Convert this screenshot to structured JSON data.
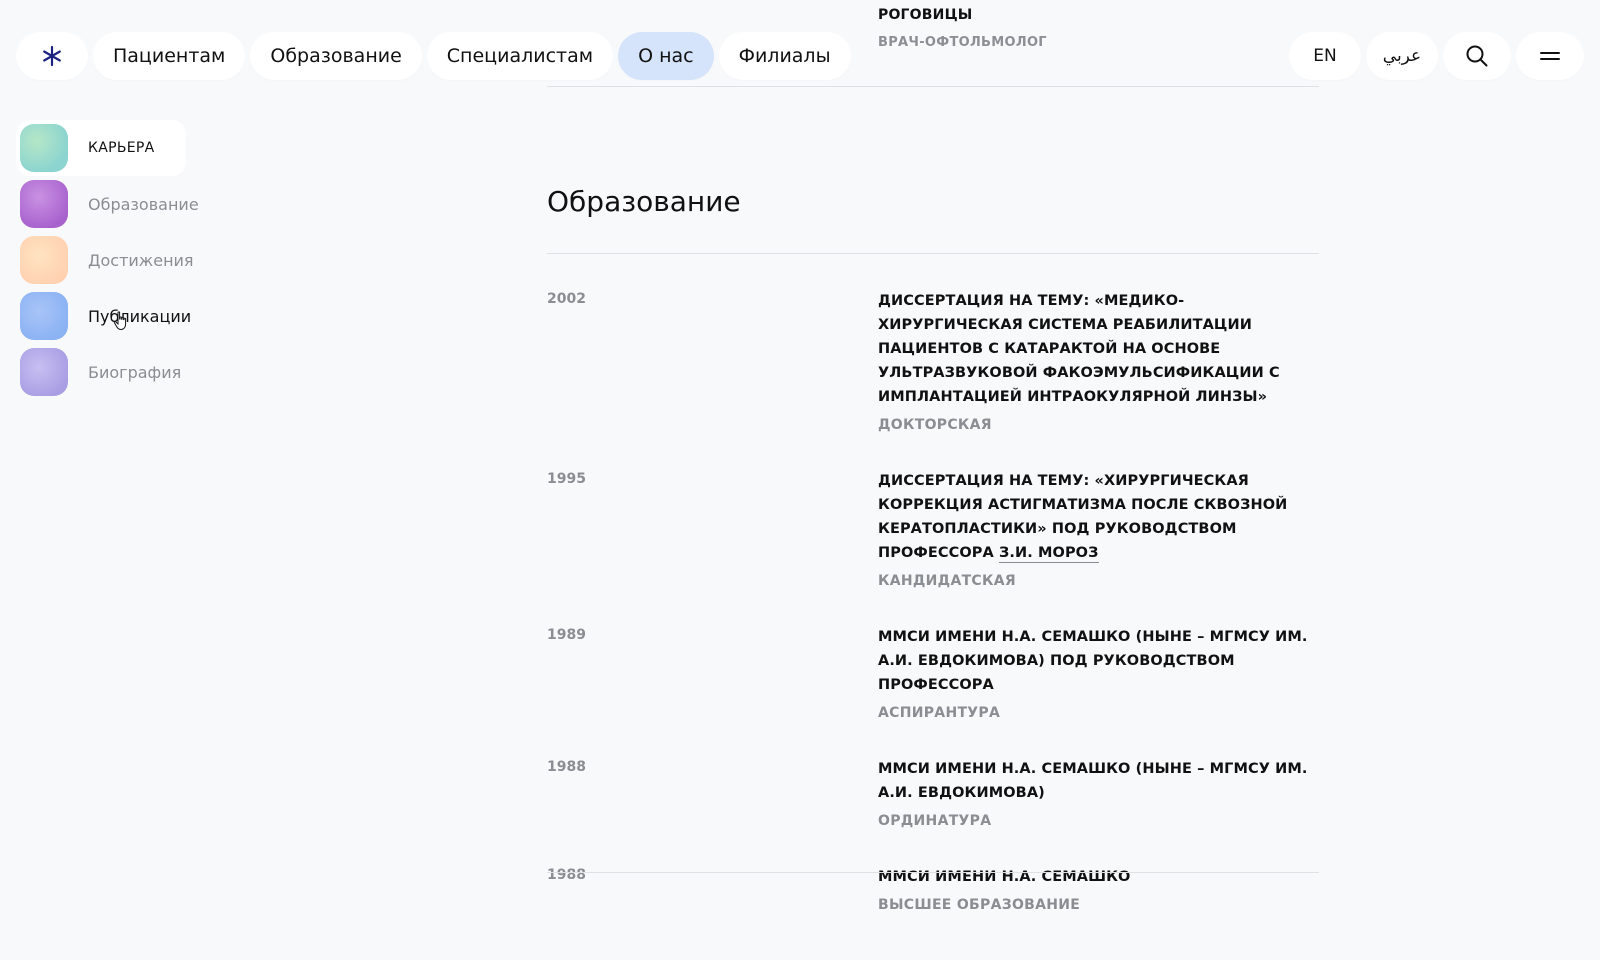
{
  "nav": {
    "items": [
      {
        "label": "Пациентам"
      },
      {
        "label": "Образование"
      },
      {
        "label": "Специалистам"
      },
      {
        "label": "О нас"
      },
      {
        "label": "Филиалы"
      }
    ],
    "lang_en": "EN",
    "lang_ar": "عربي"
  },
  "previous_section": {
    "title_tail": "РОГОВИЦЫ",
    "role": "ВРАЧ-ОФТОЛЬМОЛОГ"
  },
  "sidebar": {
    "items": [
      {
        "label": "КАРЬЕРА",
        "color_a": "#8fd3cf",
        "color_b": "#b7e6c8"
      },
      {
        "label": "Образование",
        "color_a": "#a663c9",
        "color_b": "#c792e0"
      },
      {
        "label": "Достижения",
        "color_a": "#ffd1b3",
        "color_b": "#ffe3c2"
      },
      {
        "label": "Публикации",
        "color_a": "#8db2f0",
        "color_b": "#a9c4f5"
      },
      {
        "label": "Биография",
        "color_a": "#a99ee0",
        "color_b": "#c7bff0"
      }
    ]
  },
  "main": {
    "section_title": "Образование",
    "rows": [
      {
        "year": "2002",
        "desc": "ДИССЕРТАЦИЯ НА ТЕМУ: «МЕДИКО-ХИРУРГИЧЕСКАЯ СИСТЕМА РЕАБИЛИТАЦИИ ПАЦИЕНТОВ С КАТАРАКТОЙ НА ОСНОВЕ УЛЬТРАЗВУКОВОЙ ФАКОЭМУЛЬСИФИКАЦИИ С ИМПЛАНТАЦИЕЙ ИНТРАОКУЛЯРНОЙ ЛИНЗЫ»",
        "kind": "ДОКТОРСКАЯ"
      },
      {
        "year": "1995",
        "desc": "ДИССЕРТАЦИЯ НА ТЕМУ: «ХИРУРГИЧЕСКАЯ КОРРЕКЦИЯ АСТИГМАТИЗМА ПОСЛЕ СКВОЗНОЙ КЕРАТОПЛАСТИКИ» ПОД РУКОВОДСТВОМ ПРОФЕССОРА",
        "link": "З.И. МОРОЗ",
        "kind": "КАНДИДАТСКАЯ"
      },
      {
        "year": "1989",
        "desc": "ММСИ ИМЕНИ Н.А. СЕМАШКО (НЫНЕ – МГМСУ ИМ. А.И. ЕВДОКИМОВА) ПОД РУКОВОДСТВОМ ПРОФЕССОРА",
        "kind": "АСПИРАНТУРА"
      },
      {
        "year": "1988",
        "desc": "ММСИ ИМЕНИ Н.А. СЕМАШКО (НЫНЕ – МГМСУ ИМ. А.И. ЕВДОКИМОВА)",
        "kind": "ОРДИНАТУРА"
      },
      {
        "year": "1988",
        "desc": "ММСИ ИМЕНИ Н.А. СЕМАШКО",
        "kind": "ВЫСШЕЕ ОБРАЗОВАНИЕ"
      }
    ]
  },
  "colors": {
    "logo": "#1a237e",
    "active_nav": "#d5e3fb"
  },
  "icons": {
    "logo": "asterisk-logo-icon",
    "search": "search-icon",
    "menu": "menu-icon"
  }
}
